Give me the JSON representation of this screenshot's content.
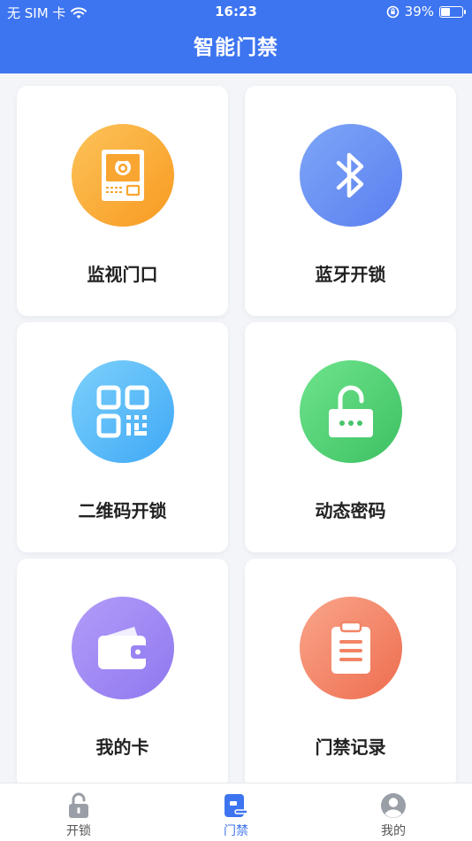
{
  "status_bar": {
    "carrier": "无 SIM 卡",
    "time": "16:23",
    "battery": "39%",
    "battery_level": 0.39
  },
  "header": {
    "title": "智能门禁"
  },
  "cards": [
    {
      "label": "监视门口",
      "icon": "intercom-icon",
      "color": "#f89a20"
    },
    {
      "label": "蓝牙开锁",
      "icon": "bluetooth-icon",
      "color": "#5b7ff0"
    },
    {
      "label": "二维码开锁",
      "icon": "qr-code-icon",
      "color": "#3fa8f6"
    },
    {
      "label": "动态密码",
      "icon": "unlock-password-icon",
      "color": "#3dc062"
    },
    {
      "label": "我的卡",
      "icon": "wallet-icon",
      "color": "#8f78ef"
    },
    {
      "label": "门禁记录",
      "icon": "clipboard-icon",
      "color": "#ee6d4f"
    }
  ],
  "tabs": [
    {
      "label": "开锁",
      "icon": "lock-icon",
      "active": false
    },
    {
      "label": "门禁",
      "icon": "door-access-icon",
      "active": true
    },
    {
      "label": "我的",
      "icon": "profile-icon",
      "active": false
    }
  ],
  "colors": {
    "primary": "#3d74f0",
    "tab_inactive": "#9a9ea6"
  }
}
